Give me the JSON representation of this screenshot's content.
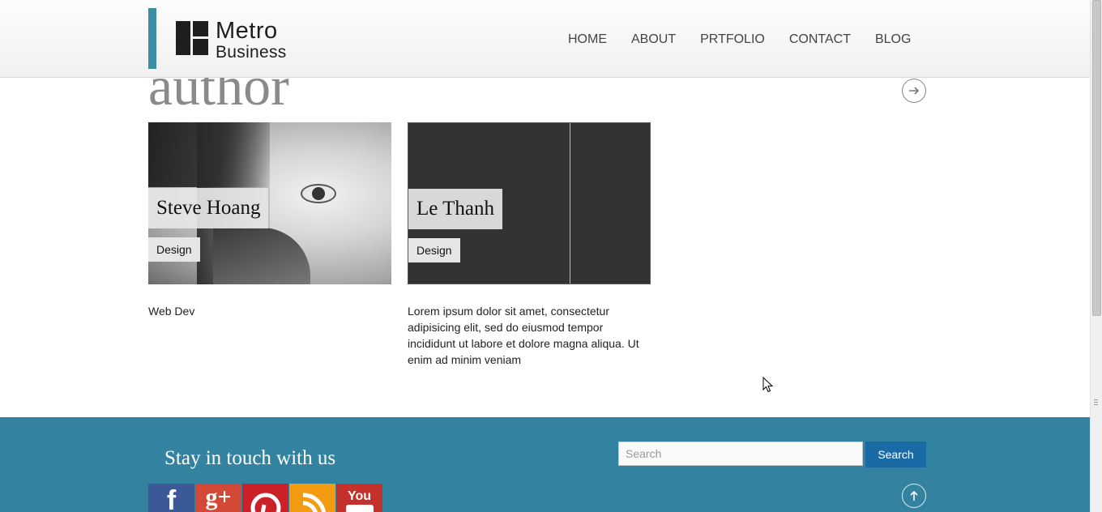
{
  "header": {
    "logo": {
      "line1": "Metro",
      "line2": "Business"
    },
    "nav": [
      "HOME",
      "ABOUT",
      "PRTFOLIO",
      "CONTACT",
      "BLOG"
    ]
  },
  "section": {
    "title": "author",
    "next_icon": "arrow-right-circle-icon"
  },
  "cards": [
    {
      "name": "Steve Hoang",
      "tag": "Design",
      "description": "Web Dev"
    },
    {
      "name": "Le Thanh",
      "tag": "Design",
      "description": "Lorem ipsum dolor sit amet, consectetur adipisicing elit, sed do eiusmod tempor incididunt ut labore et dolore magna aliqua. Ut enim ad minim veniam"
    }
  ],
  "footer": {
    "title": "Stay in touch with us",
    "search_placeholder": "Search",
    "search_button": "Search",
    "social": [
      {
        "name": "facebook-icon",
        "glyph": "f"
      },
      {
        "name": "google-plus-icon",
        "glyph": "g+"
      },
      {
        "name": "pinterest-icon",
        "glyph": ""
      },
      {
        "name": "rss-icon",
        "glyph": ""
      },
      {
        "name": "youtube-icon",
        "glyph": "You"
      }
    ],
    "top_icon": "arrow-up-circle-icon"
  },
  "colors": {
    "accent": "#3a8ea6",
    "footer_bg": "#3383a0",
    "search_button": "#1a6aa6",
    "title_gray": "#8a8a8a"
  }
}
